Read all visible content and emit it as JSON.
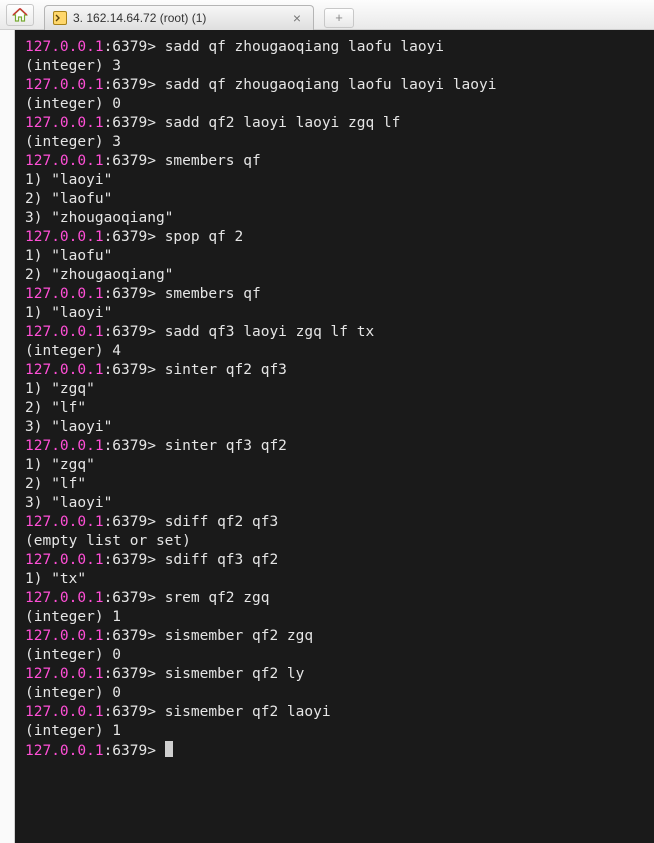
{
  "tab": {
    "title": "3. 162.14.64.72 (root) (1)",
    "close_glyph": "×",
    "newtab_glyph": "+"
  },
  "prompt": {
    "host": "127.0.0.1",
    "port": ":6379>"
  },
  "session": [
    {
      "type": "cmd",
      "text": "sadd qf zhougaoqiang laofu laoyi"
    },
    {
      "type": "out",
      "text": "(integer) 3"
    },
    {
      "type": "cmd",
      "text": "sadd qf zhougaoqiang laofu laoyi laoyi"
    },
    {
      "type": "out",
      "text": "(integer) 0"
    },
    {
      "type": "cmd",
      "text": "sadd qf2 laoyi laoyi zgq lf"
    },
    {
      "type": "out",
      "text": "(integer) 3"
    },
    {
      "type": "cmd",
      "text": "smembers qf"
    },
    {
      "type": "out",
      "text": "1) \"laoyi\""
    },
    {
      "type": "out",
      "text": "2) \"laofu\""
    },
    {
      "type": "out",
      "text": "3) \"zhougaoqiang\""
    },
    {
      "type": "cmd",
      "text": "spop qf 2"
    },
    {
      "type": "out",
      "text": "1) \"laofu\""
    },
    {
      "type": "out",
      "text": "2) \"zhougaoqiang\""
    },
    {
      "type": "cmd",
      "text": "smembers qf"
    },
    {
      "type": "out",
      "text": "1) \"laoyi\""
    },
    {
      "type": "cmd",
      "text": "sadd qf3 laoyi zgq lf tx"
    },
    {
      "type": "out",
      "text": "(integer) 4"
    },
    {
      "type": "cmd",
      "text": "sinter qf2 qf3"
    },
    {
      "type": "out",
      "text": "1) \"zgq\""
    },
    {
      "type": "out",
      "text": "2) \"lf\""
    },
    {
      "type": "out",
      "text": "3) \"laoyi\""
    },
    {
      "type": "cmd",
      "text": "sinter qf3 qf2"
    },
    {
      "type": "out",
      "text": "1) \"zgq\""
    },
    {
      "type": "out",
      "text": "2) \"lf\""
    },
    {
      "type": "out",
      "text": "3) \"laoyi\""
    },
    {
      "type": "cmd",
      "text": "sdiff qf2 qf3"
    },
    {
      "type": "out",
      "text": "(empty list or set)"
    },
    {
      "type": "cmd",
      "text": "sdiff qf3 qf2"
    },
    {
      "type": "out",
      "text": "1) \"tx\""
    },
    {
      "type": "cmd",
      "text": "srem qf2 zgq"
    },
    {
      "type": "out",
      "text": "(integer) 1"
    },
    {
      "type": "cmd",
      "text": "sismember qf2 zgq"
    },
    {
      "type": "out",
      "text": "(integer) 0"
    },
    {
      "type": "cmd",
      "text": "sismember qf2 ly"
    },
    {
      "type": "out",
      "text": "(integer) 0"
    },
    {
      "type": "cmd",
      "text": "sismember qf2 laoyi"
    },
    {
      "type": "out",
      "text": "(integer) 1"
    },
    {
      "type": "cursor"
    }
  ]
}
